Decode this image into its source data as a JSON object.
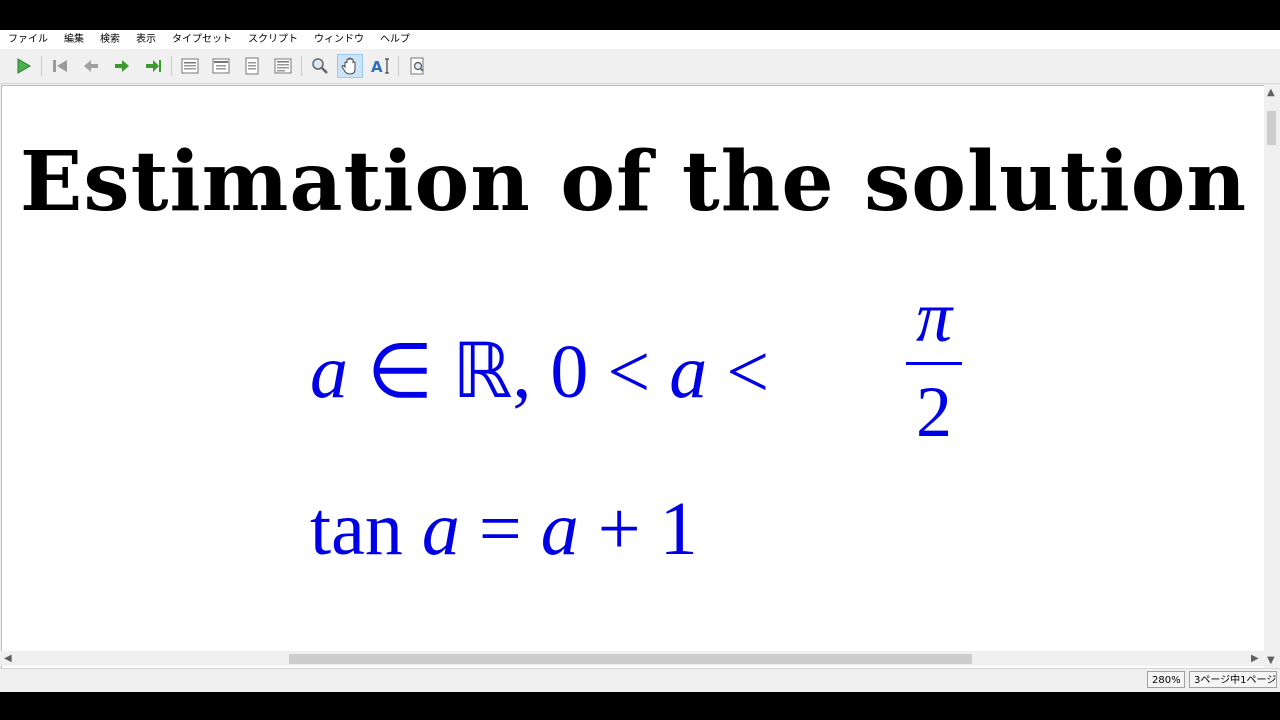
{
  "menu": [
    "ファイル",
    "編集",
    "検索",
    "表示",
    "タイプセット",
    "スクリプト",
    "ウィンドウ",
    "ヘルプ"
  ],
  "document": {
    "title": "Estimation of the solution",
    "line1": {
      "a": "a",
      "rest": " ∈ ℝ, 0 < ",
      "a2": "a",
      "lt": " <",
      "num": "π",
      "den": "2"
    },
    "line2": {
      "tan": "tan ",
      "a": "a",
      "eq": " = ",
      "a2": "a",
      "plus": " + 1"
    }
  },
  "status": {
    "zoom": "280%",
    "page": "3ページ中1ページ"
  },
  "colors": {
    "math": "#0000e6",
    "play": "#4caf50",
    "nav": "#3a9a2a"
  },
  "toolbar_icons": [
    "play-icon",
    "first-page-icon",
    "prev-page-icon",
    "next-page-icon",
    "last-page-icon",
    "fit-page-icon",
    "fit-width-icon",
    "single-page-icon",
    "continuous-icon",
    "magnifier-icon",
    "hand-tool-icon",
    "text-select-icon",
    "find-icon"
  ]
}
